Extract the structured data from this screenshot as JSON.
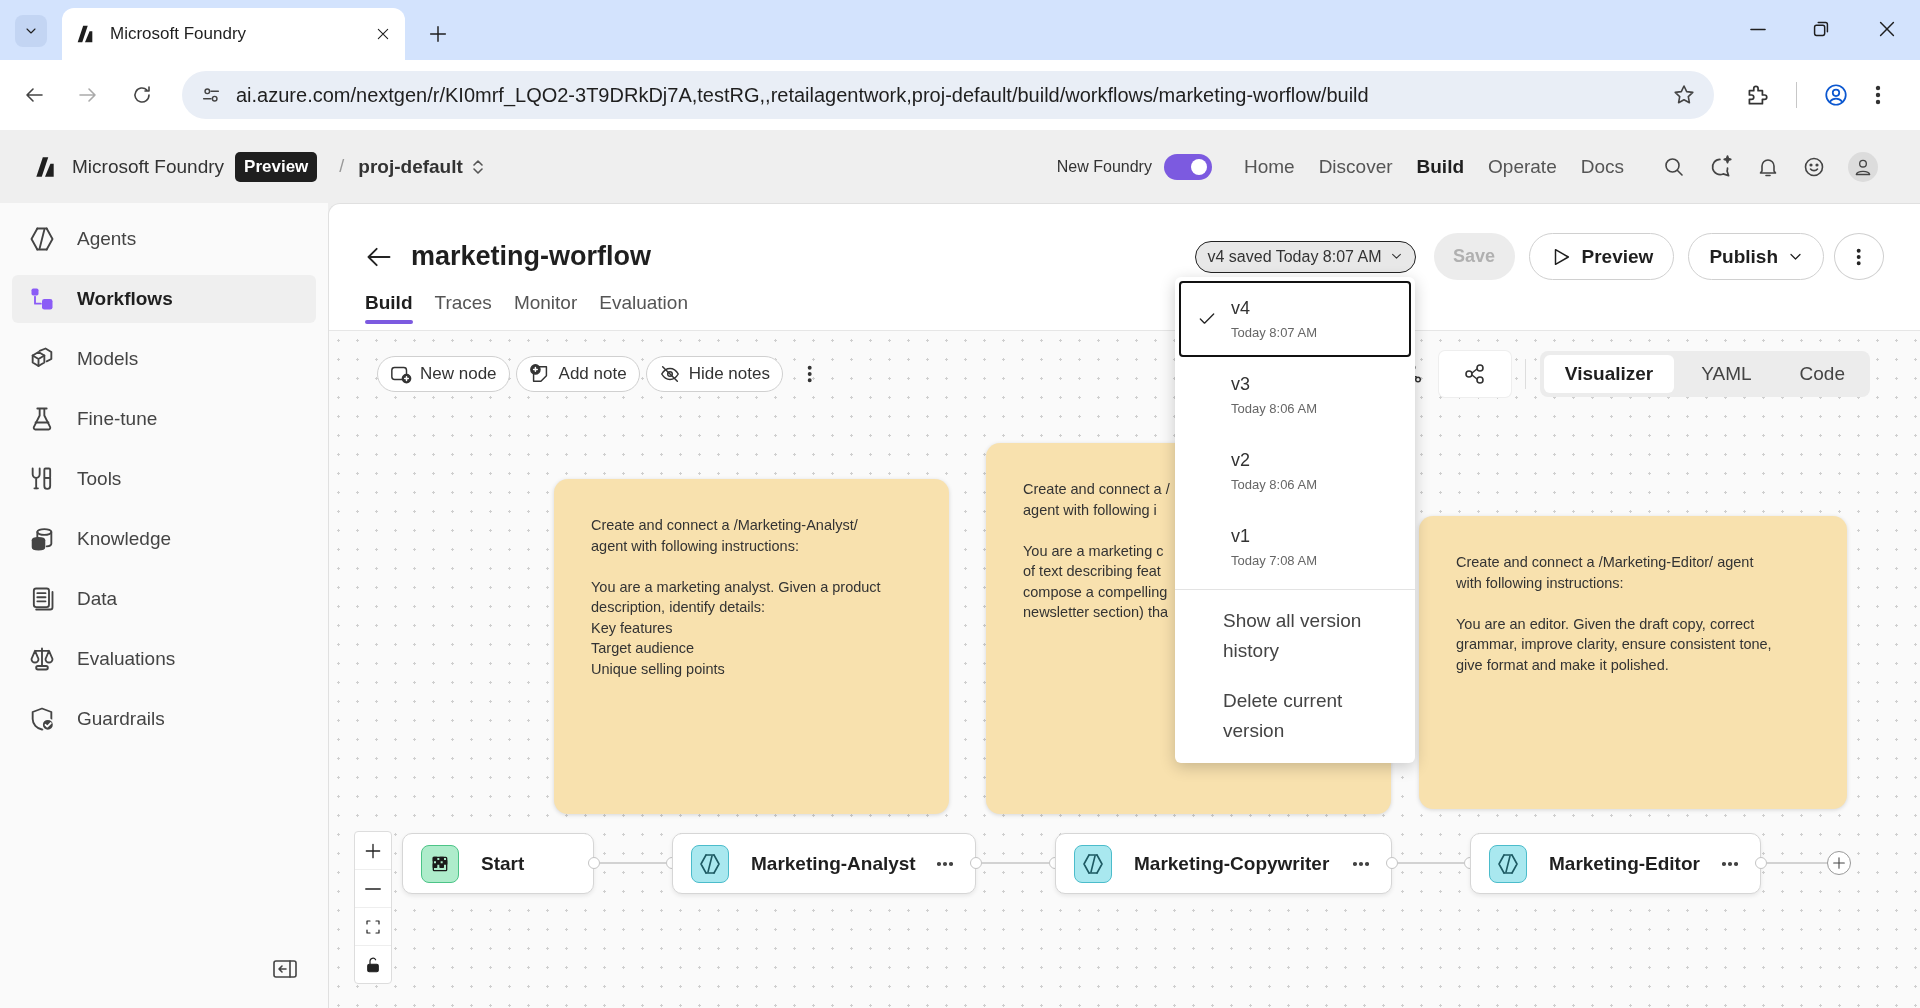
{
  "browser": {
    "tab_title": "Microsoft Foundry",
    "url": "ai.azure.com/nextgen/r/KI0mrf_LQO2-3T9DRkDj7A,testRG,,retailagentwork,proj-default/build/workflows/marketing-worflow/build"
  },
  "header": {
    "brand": "Microsoft Foundry",
    "badge": "Preview",
    "separator": "/",
    "project": "proj-default",
    "toggle": {
      "label": "New Foundry",
      "on": true
    },
    "nav": [
      {
        "label": "Home",
        "selected": false
      },
      {
        "label": "Discover",
        "selected": false
      },
      {
        "label": "Build",
        "selected": true
      },
      {
        "label": "Operate",
        "selected": false
      },
      {
        "label": "Docs",
        "selected": false
      }
    ]
  },
  "sidebar": {
    "items": [
      {
        "label": "Agents",
        "selected": false
      },
      {
        "label": "Workflows",
        "selected": true
      },
      {
        "label": "Models",
        "selected": false
      },
      {
        "label": "Fine-tune",
        "selected": false
      },
      {
        "label": "Tools",
        "selected": false
      },
      {
        "label": "Knowledge",
        "selected": false
      },
      {
        "label": "Data",
        "selected": false
      },
      {
        "label": "Evaluations",
        "selected": false
      },
      {
        "label": "Guardrails",
        "selected": false
      }
    ]
  },
  "workflow": {
    "title": "marketing-worflow",
    "tabs": [
      {
        "label": "Build",
        "selected": true
      },
      {
        "label": "Traces",
        "selected": false
      },
      {
        "label": "Monitor",
        "selected": false
      },
      {
        "label": "Evaluation",
        "selected": false
      }
    ],
    "version_button": "v4 saved Today 8:07 AM",
    "save": {
      "label": "Save",
      "disabled": true
    },
    "preview": "Preview",
    "publish": "Publish"
  },
  "toolbar": {
    "actions": [
      "New node",
      "Add note",
      "Hide notes"
    ],
    "views": [
      {
        "label": "Visualizer",
        "selected": true
      },
      {
        "label": "YAML",
        "selected": false
      },
      {
        "label": "Code",
        "selected": false
      }
    ]
  },
  "notes": [
    {
      "text": "Create and connect a /Marketing-Analyst/\nagent with following instructions:\n\nYou are a marketing analyst. Given a product\ndescription, identify details:\nKey features\nTarget audience\nUnique selling points"
    },
    {
      "text": "Create and connect a /\nagent with following i\n\nYou are a marketing c\nof text describing feat\ncompose a compelling\nnewsletter section) tha"
    },
    {
      "text": "Create and connect a /Marketing-Editor/ agent\nwith following instructions:\n\nYou are an editor. Given the draft copy, correct\ngrammar, improve clarity, ensure consistent tone,\ngive format and make it polished."
    }
  ],
  "nodes": [
    {
      "label": "Start",
      "kind": "start"
    },
    {
      "label": "Marketing-Analyst",
      "kind": "agent"
    },
    {
      "label": "Marketing-Copywriter",
      "kind": "agent"
    },
    {
      "label": "Marketing-Editor",
      "kind": "agent"
    }
  ],
  "version_menu": {
    "versions": [
      {
        "label": "v4",
        "time": "Today 8:07 AM",
        "selected": true
      },
      {
        "label": "v3",
        "time": "Today 8:06 AM",
        "selected": false
      },
      {
        "label": "v2",
        "time": "Today 8:06 AM",
        "selected": false
      },
      {
        "label": "v1",
        "time": "Today 7:08 AM",
        "selected": false
      }
    ],
    "actions": [
      "Show all version history",
      "Delete current version"
    ]
  }
}
